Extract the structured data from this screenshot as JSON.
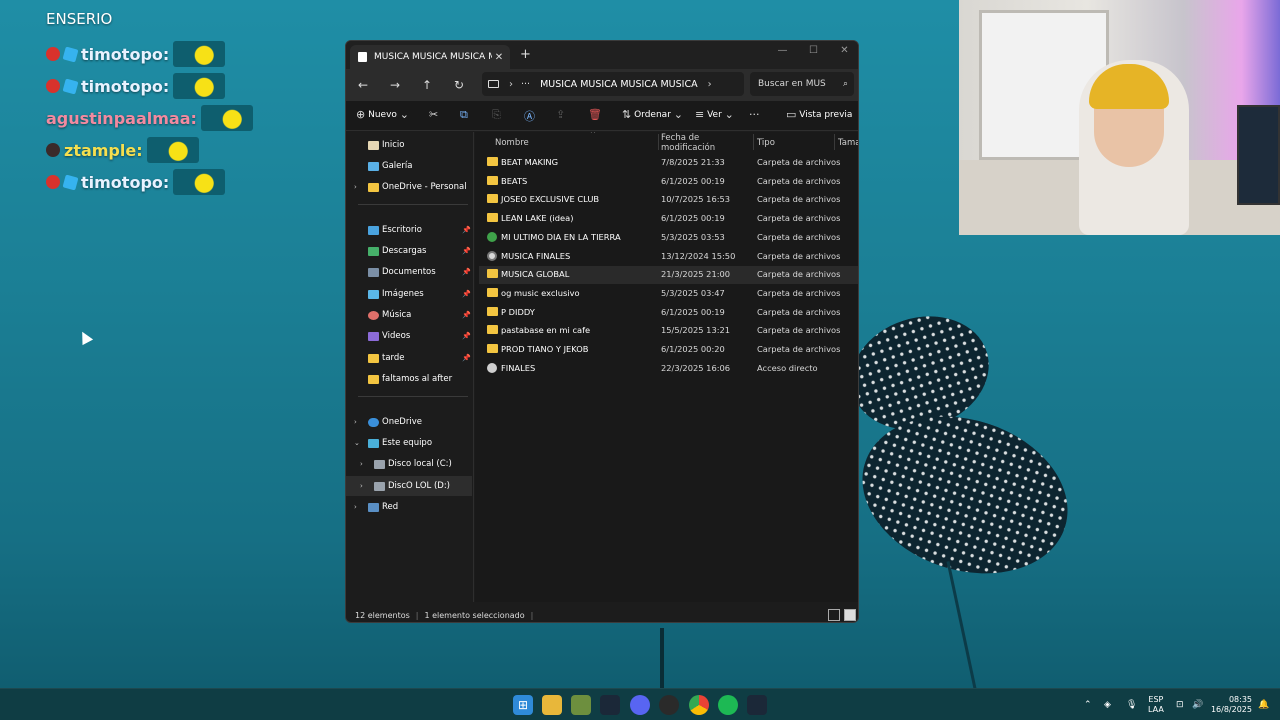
{
  "chat": {
    "header": "ENSERIO",
    "messages": [
      {
        "user": "timotopo:",
        "color": "#e8f2ff"
      },
      {
        "user": "timotopo:",
        "color": "#e8f2ff"
      },
      {
        "user": "agustinpaalmaa:",
        "color": "#f28aa0"
      },
      {
        "user": "ztample:",
        "color": "#f5df4f"
      },
      {
        "user": "timotopo:",
        "color": "#e8f2ff"
      }
    ]
  },
  "explorer": {
    "tab_title": "MUSICA MUSICA MUSICA MU",
    "tab_close": "✕",
    "tab_add": "+",
    "window_buttons": {
      "minimize": "—",
      "maximize": "☐",
      "close": "✕"
    },
    "address": {
      "dots": "···",
      "path": "MUSICA MUSICA MUSICA MUSICA"
    },
    "search_placeholder": "Buscar en MUS",
    "toolbar": {
      "new": "Nuevo",
      "sort": "Ordenar",
      "view": "Ver",
      "more": "···",
      "preview": "Vista previa"
    },
    "nav": {
      "home": "Inicio",
      "gallery": "Galería",
      "onedrive_personal": "OneDrive - Personal",
      "desktop": "Escritorio",
      "downloads": "Descargas",
      "documents": "Documentos",
      "images": "Imágenes",
      "music": "Música",
      "videos": "Videos",
      "tarde": "tarde",
      "faltamos": "faltamos al after",
      "onedrive": "OneDrive",
      "this_pc": "Este equipo",
      "disk_c": "Disco local (C:)",
      "disk_d": "DiscO LOL (D:)",
      "network": "Red"
    },
    "columns": {
      "name": "Nombre",
      "modified": "Fecha de modificación",
      "type": "Tipo",
      "size": "Tamaño"
    },
    "files": [
      {
        "name": "BEAT MAKING",
        "date": "7/8/2025 21:33",
        "type": "Carpeta de archivos",
        "icon": "folder-icon"
      },
      {
        "name": "BEATS",
        "date": "6/1/2025 00:19",
        "type": "Carpeta de archivos",
        "icon": "folder-icon"
      },
      {
        "name": "JOSEO EXCLUSIVE CLUB",
        "date": "10/7/2025 16:53",
        "type": "Carpeta de archivos",
        "icon": "folder-icon"
      },
      {
        "name": "LEAN LAKE (idea)",
        "date": "6/1/2025 00:19",
        "type": "Carpeta de archivos",
        "icon": "folder-icon"
      },
      {
        "name": "MI ULTIMO DIA EN LA TIERRA",
        "date": "5/3/2025 03:53",
        "type": "Carpeta de archivos",
        "icon": "globe-icon"
      },
      {
        "name": "MUSICA FINALES",
        "date": "13/12/2024 15:50",
        "type": "Carpeta de archivos",
        "icon": "disc-icon"
      },
      {
        "name": "MUSICA GLOBAL",
        "date": "21/3/2025 21:00",
        "type": "Carpeta de archivos",
        "icon": "folder-icon"
      },
      {
        "name": "og music exclusivo",
        "date": "5/3/2025 03:47",
        "type": "Carpeta de archivos",
        "icon": "folder-icon"
      },
      {
        "name": "P DIDDY",
        "date": "6/1/2025 00:19",
        "type": "Carpeta de archivos",
        "icon": "folder-icon"
      },
      {
        "name": "pastabase en mi cafe",
        "date": "15/5/2025 13:21",
        "type": "Carpeta de archivos",
        "icon": "folder-icon"
      },
      {
        "name": "PROD TIANO Y JEKOB",
        "date": "6/1/2025 00:20",
        "type": "Carpeta de archivos",
        "icon": "folder-icon"
      },
      {
        "name": "FINALES",
        "date": "22/3/2025 16:06",
        "type": "Acceso directo",
        "icon": "shortcut-icon"
      }
    ],
    "status": {
      "count": "12 elementos",
      "selected": "1 elemento seleccionado"
    }
  },
  "taskbar": {
    "lang_top": "ESP",
    "lang_bottom": "LAA",
    "time": "08:35",
    "date": "16/8/2025"
  },
  "colors": {
    "accent": "#f3c541",
    "window_bg": "#1c1c1c",
    "desktop": "#1b7f95"
  }
}
